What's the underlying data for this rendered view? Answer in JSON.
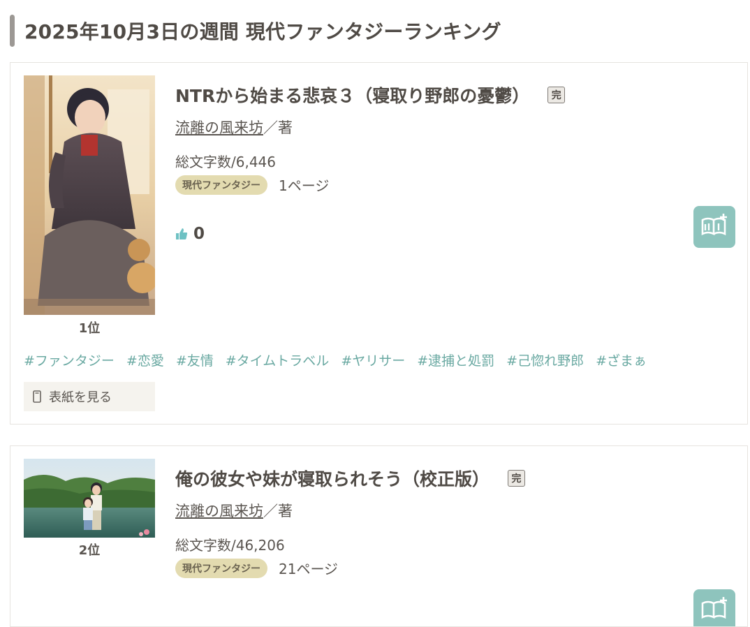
{
  "page": {
    "heading": "2025年10月3日の週間 現代ファンタジーランキング"
  },
  "colors": {
    "accent_teal": "#8ec4bd",
    "tag_teal": "#6aa9a2",
    "genre_tag_bg": "#e3dbb0"
  },
  "entries": [
    {
      "rank": "1位",
      "title": "NTRから始まる悲哀３（寝取り野郎の憂鬱）",
      "complete_badge": "完",
      "author": "流離の風来坊",
      "author_suffix": "／著",
      "char_count": "総文字数/6,446",
      "genre": "現代ファンタジー",
      "pages": "1ページ",
      "likes": "0",
      "like_icon": "thumbs-up-icon",
      "bookshelf_icon": "add-bookshelf-icon",
      "tags": [
        "#ファンタジー",
        "#恋愛",
        "#友情",
        "#タイムトラベル",
        "#ヤリサー",
        "#逮捕と処罰",
        "#己惚れ野郎",
        "#ざまぁ"
      ],
      "view_cover_label": "表紙を見る",
      "view_cover_icon": "document-icon"
    },
    {
      "rank": "2位",
      "title": "俺の彼女や妹が寝取られそう（校正版）",
      "complete_badge": "完",
      "author": "流離の風来坊",
      "author_suffix": "／著",
      "char_count": "総文字数/46,206",
      "genre": "現代ファンタジー",
      "pages": "21ページ",
      "bookshelf_icon": "add-bookshelf-icon"
    }
  ]
}
